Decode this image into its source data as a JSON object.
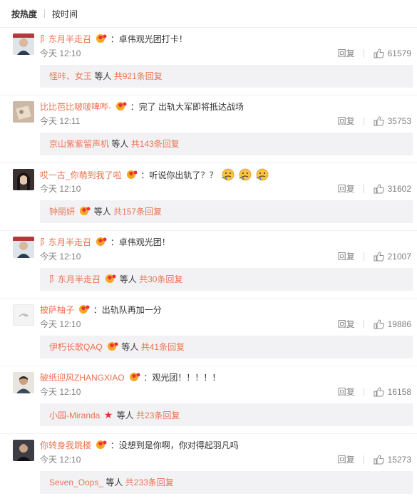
{
  "tabs": {
    "hot": "按热度",
    "time": "按时间"
  },
  "colors": {
    "link": "#eb7350",
    "text": "#333333",
    "muted": "#808080",
    "subbg": "#f2f2f5"
  },
  "comments": [
    {
      "user": "阝东月半走召",
      "text": "：卓伟观光团打卡！",
      "time": "今天 12:10",
      "reply": "回复",
      "likes": "61579",
      "sub_users": "怪咔、女王",
      "sub_etc": "等人",
      "sub_total": "共921条回复"
    },
    {
      "user": "比比芭比啵啵啤哔-",
      "text": "：完了 出轨大军即将抵达战场",
      "time": "今天 12:11",
      "reply": "回复",
      "likes": "35753",
      "sub_users": "京山紫紫留声机",
      "sub_etc": "等人",
      "sub_total": "共143条回复"
    },
    {
      "user": "哎一古_你萌到我了啦",
      "text": "：听说你出轨了？？",
      "time": "今天 12:10",
      "reply": "回复",
      "likes": "31602",
      "sub_users": "钟丽妍",
      "sub_etc": "等人",
      "sub_total": "共157条回复"
    },
    {
      "user": "阝东月半走召",
      "text": "：卓伟观光团！",
      "time": "今天 12:10",
      "reply": "回复",
      "likes": "21007",
      "sub_users": "阝东月半走召",
      "sub_etc": "等人",
      "sub_total": "共30条回复"
    },
    {
      "user": "披萨柚子",
      "text": "：出轨队再加一分",
      "time": "今天 12:10",
      "reply": "回复",
      "likes": "19886",
      "sub_users": "伊朽长歌QAQ",
      "sub_etc": "等人",
      "sub_total": "共41条回复"
    },
    {
      "user": "破纸迎风ZHANGXIAO",
      "text": "：观光团！！！！！",
      "time": "今天 12:10",
      "reply": "回复",
      "likes": "16158",
      "sub_users": "小园-Miranda",
      "sub_etc": "等人",
      "sub_total": "共23条回复"
    },
    {
      "user": "你转身我跳楼",
      "text": "：没想到是你啊，你对得起羽凡吗",
      "time": "今天 12:10",
      "reply": "回复",
      "likes": "15273",
      "sub_users": "Seven_Oops_",
      "sub_etc": "等人",
      "sub_total": "共233条回复"
    }
  ]
}
